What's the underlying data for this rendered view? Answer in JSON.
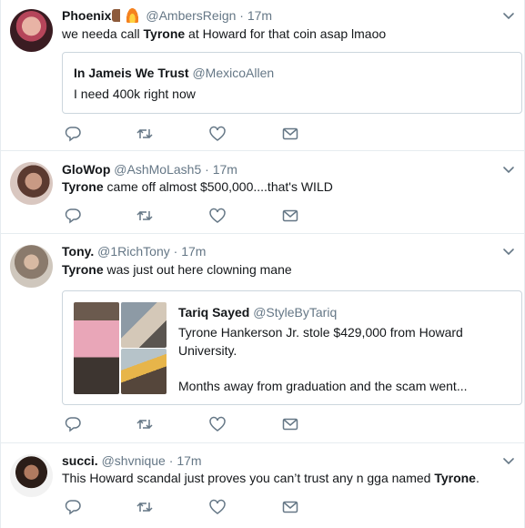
{
  "icons": {
    "reply": "reply-icon",
    "retweet": "retweet-icon",
    "like": "heart-icon",
    "message": "envelope-icon",
    "caret": "chevron-down-icon"
  },
  "colors": {
    "icon": "#657786",
    "name": "#14171a",
    "muted": "#657786",
    "border": "#e6ecf0"
  },
  "tweets": [
    {
      "name": "Phoenix",
      "handle": "@AmbersReign",
      "dot": "·",
      "time": "17m",
      "text_pre": "we needa call ",
      "text_bold": "Tyrone",
      "text_post": " at Howard for that coin asap lmaoo",
      "quote": {
        "name": "In Jameis We Trust",
        "handle": "@MexicoAllen",
        "text": "I need 400k right now"
      }
    },
    {
      "name": "GloWop",
      "handle": "@AshMoLash5",
      "dot": "·",
      "time": "17m",
      "text_bold": "Tyrone",
      "text_post": " came off almost $500,000....that's WILD"
    },
    {
      "name": "Tony.",
      "handle": "@1RichTony",
      "dot": "·",
      "time": "17m",
      "text_bold": "Tyrone",
      "text_post": " was just out here clowning mane",
      "quote": {
        "name": "Tariq Sayed",
        "handle": "@StyleByTariq",
        "line1": "Tyrone Hankerson Jr. stole $429,000 from Howard",
        "line2": "University.",
        "line3": "Months away from graduation and the scam went..."
      }
    },
    {
      "name": "succi.",
      "handle": "@shvnique",
      "dot": "·",
      "time": "17m",
      "text_pre": "This Howard scandal just proves you can’t trust any n ɡga named ",
      "text_bold": "Tyrone",
      "text_post": "."
    }
  ]
}
